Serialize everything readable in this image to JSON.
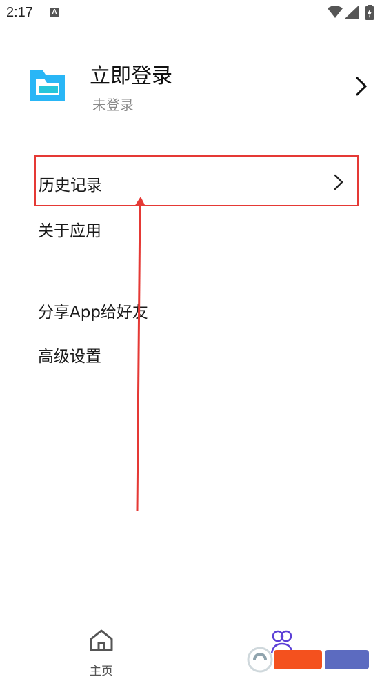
{
  "status_bar": {
    "time": "2:17",
    "notification_letter": "A"
  },
  "profile": {
    "title": "立即登录",
    "subtitle": "未登录"
  },
  "menu": {
    "items": [
      {
        "label": "历史记录"
      },
      {
        "label": "关于应用"
      },
      {
        "label": "分享App给好友"
      },
      {
        "label": "高级设置"
      }
    ]
  },
  "bottom_nav": {
    "home_label": "主页"
  },
  "colors": {
    "highlight_box": "#e53935",
    "logo_cyan": "#29b6f6",
    "logo_teal": "#26c6da",
    "nav_active": "#5b3fd6"
  }
}
